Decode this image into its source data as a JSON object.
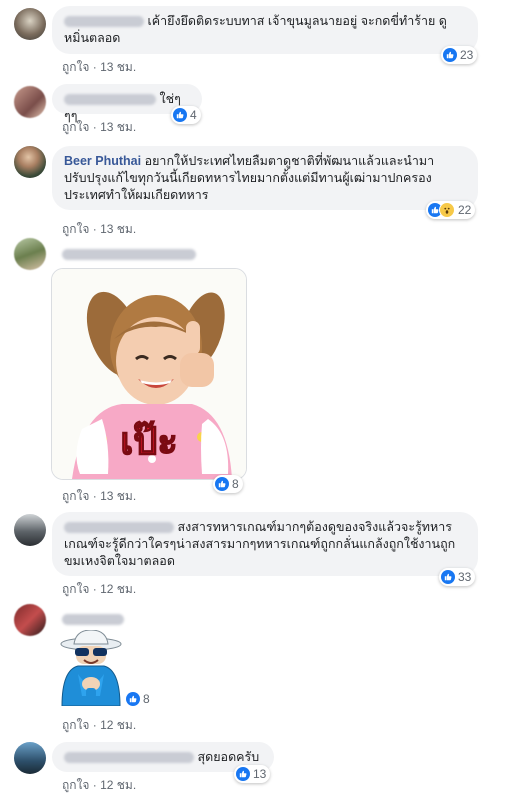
{
  "comments": [
    {
      "text": "เค้ายึงยึดติดระบบทาส เจ้าขุนมูลนายอยู่ จะกดขี่ทำร้าย ดูหมิ่นตลอด",
      "like": "ถูกใจ",
      "time": "13 ชม.",
      "count": "23"
    },
    {
      "text": "ใช่ๆๆๆ",
      "like": "ถูกใจ",
      "time": "13 ชม.",
      "count": "4"
    },
    {
      "author": "Beer Phuthai",
      "text": "อยากให้ประเทศไทยลืมตาดูชาติที่พัฒนาแล้วและนำมาปรับปรุงแก้ไขทุกวันนี้เกียดทหารไทยมากตั้งแต่มีทานผู้เฒ่ามาปกครองประเทศทำให้ผมเกียดทหาร",
      "like": "ถูกใจ",
      "time": "13 ชม.",
      "count": "22"
    },
    {
      "sticker_text": "เป๊ะ",
      "like": "ถูกใจ",
      "time": "13 ชม.",
      "count": "8"
    },
    {
      "text": "สงสารทหารเกณฑ์มากๆต้องดูของจริงแล้วจะรู้ทหารเกณฑ์จะรู้ดีกว่าใครๆน่าสงสารมากๆทหารเกณฑ์ถูกกลั่นแกล้งถูกใช้งานถูกขมเหงจิตใจมาตลอด",
      "like": "ถูกใจ",
      "time": "12 ชม.",
      "count": "33"
    },
    {
      "like": "ถูกใจ",
      "time": "12 ชม.",
      "count": "8"
    },
    {
      "text": "สุดยอดครับ",
      "like": "ถูกใจ",
      "time": "12 ชม.",
      "count": "13"
    }
  ],
  "separator": "·",
  "colors": {
    "link": "#385898",
    "bubble": "#f2f3f5",
    "like": "#1877f2"
  }
}
